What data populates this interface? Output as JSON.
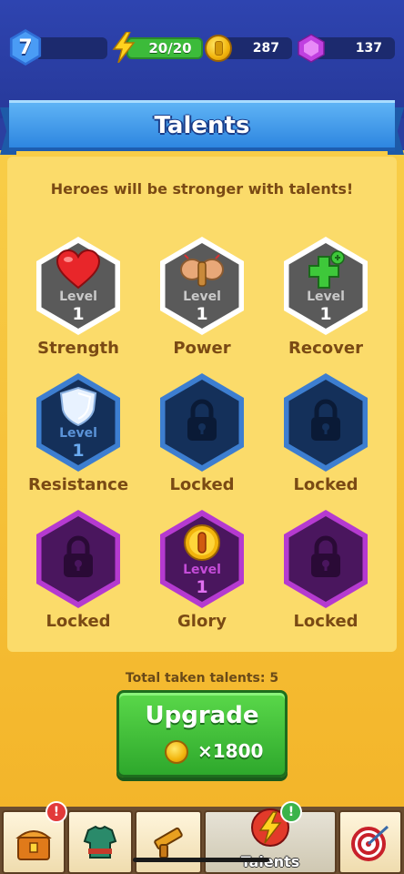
{
  "top_bar": {
    "player_level": "7",
    "energy": "20/20",
    "coins": "287",
    "gems": "137"
  },
  "title": "Talents",
  "subtitle": "Heroes will be stronger with talents!",
  "level_label": "Level",
  "talents": [
    {
      "name": "Strength",
      "level": "1",
      "icon": "heart-icon"
    },
    {
      "name": "Power",
      "level": "1",
      "icon": "fist-icon"
    },
    {
      "name": "Recover",
      "level": "1",
      "icon": "plus-icon"
    },
    {
      "name": "Resistance",
      "level": "1",
      "icon": "shield-icon"
    },
    {
      "name": "Locked",
      "icon": "lock-icon"
    },
    {
      "name": "Locked",
      "icon": "lock-icon"
    },
    {
      "name": "Locked",
      "icon": "lock-icon"
    },
    {
      "name": "Glory",
      "level": "1",
      "icon": "gold-coin-icon"
    },
    {
      "name": "Locked",
      "icon": "lock-icon"
    }
  ],
  "total_taken": "Total taken talents: 5",
  "upgrade": {
    "label": "Upgrade",
    "cost": "×1800"
  },
  "nav": {
    "talents_label": "Talents",
    "badge_alert": "!",
    "items": [
      "chest-icon",
      "armor-icon",
      "gun-icon",
      "talents-icon",
      "target-icon"
    ]
  },
  "colors": {
    "accent_blue": "#2e86e0",
    "panel_yellow": "#fbdb6a",
    "upgrade_green": "#3cbb3a",
    "text_brown": "#7a4a14"
  }
}
